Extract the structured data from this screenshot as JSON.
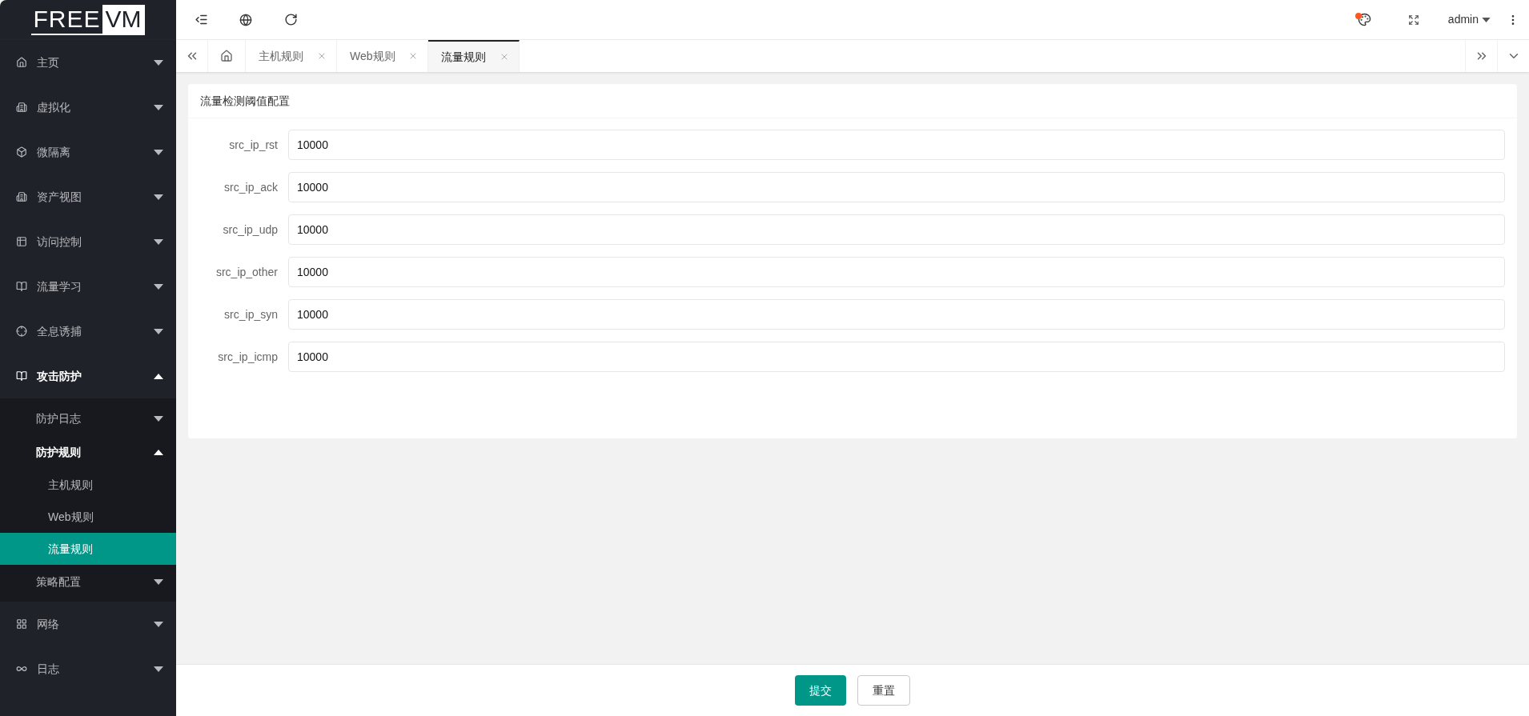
{
  "logo": {
    "left": "FREE",
    "right": "VM"
  },
  "sidebar": {
    "items": [
      {
        "label": "主页",
        "expanded": false
      },
      {
        "label": "虚拟化",
        "expanded": false
      },
      {
        "label": "微隔离",
        "expanded": false
      },
      {
        "label": "资产视图",
        "expanded": false
      },
      {
        "label": "访问控制",
        "expanded": false
      },
      {
        "label": "流量学习",
        "expanded": false
      },
      {
        "label": "全息诱捕",
        "expanded": false
      },
      {
        "label": "攻击防护",
        "expanded": true,
        "children": [
          {
            "label": "防护日志",
            "expanded": false
          },
          {
            "label": "防护规则",
            "expanded": true,
            "children": [
              {
                "label": "主机规则",
                "selected": false
              },
              {
                "label": "Web规则",
                "selected": false
              },
              {
                "label": "流量规则",
                "selected": true
              }
            ]
          },
          {
            "label": "策略配置",
            "expanded": false
          }
        ]
      },
      {
        "label": "网络",
        "expanded": false
      },
      {
        "label": "日志",
        "expanded": false
      }
    ]
  },
  "header": {
    "user": "admin",
    "notification": true
  },
  "tabs": [
    {
      "label": "主机规则",
      "selected": false
    },
    {
      "label": "Web规则",
      "selected": false
    },
    {
      "label": "流量规则",
      "selected": true
    }
  ],
  "card": {
    "title": "流量检测阈值配置",
    "fields": [
      {
        "label": "src_ip_rst",
        "value": "10000"
      },
      {
        "label": "src_ip_ack",
        "value": "10000"
      },
      {
        "label": "src_ip_udp",
        "value": "10000"
      },
      {
        "label": "src_ip_other",
        "value": "10000"
      },
      {
        "label": "src_ip_syn",
        "value": "10000"
      },
      {
        "label": "src_ip_icmp",
        "value": "10000"
      }
    ]
  },
  "buttons": [
    {
      "label": "提交",
      "kind": "primary"
    },
    {
      "label": "重置",
      "kind": "default"
    }
  ]
}
